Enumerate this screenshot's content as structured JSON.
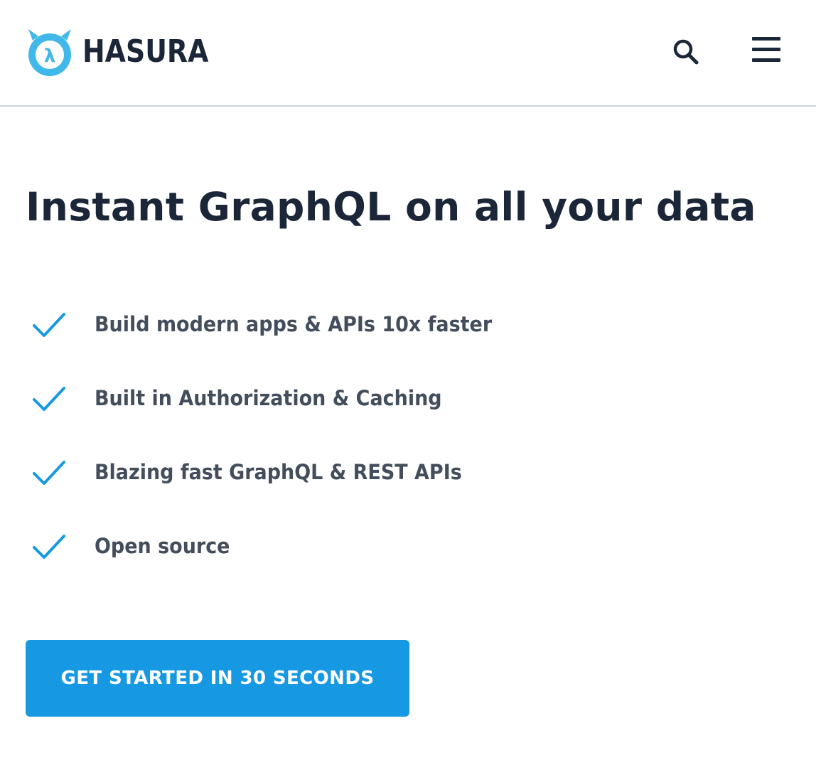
{
  "header": {
    "brand": "HASURA",
    "logo_icon": "hasura-lambda-logo",
    "search_icon": "search-icon",
    "menu_icon": "hamburger-menu-icon"
  },
  "hero": {
    "headline": "Instant GraphQL on all your data",
    "features": [
      {
        "icon": "checkmark-icon",
        "text": "Build modern apps & APIs 10x faster"
      },
      {
        "icon": "checkmark-icon",
        "text": "Built in Authorization & Caching"
      },
      {
        "icon": "checkmark-icon",
        "text": "Blazing fast GraphQL & REST APIs"
      },
      {
        "icon": "checkmark-icon",
        "text": "Open source"
      }
    ],
    "cta_label": "GET STARTED IN 30 SECONDS"
  },
  "colors": {
    "brand_blue": "#1699e2",
    "logo_blue": "#40b8ea",
    "text_dark": "#1b2738",
    "text_muted": "#434d5c",
    "divider": "#c9d3dc"
  }
}
